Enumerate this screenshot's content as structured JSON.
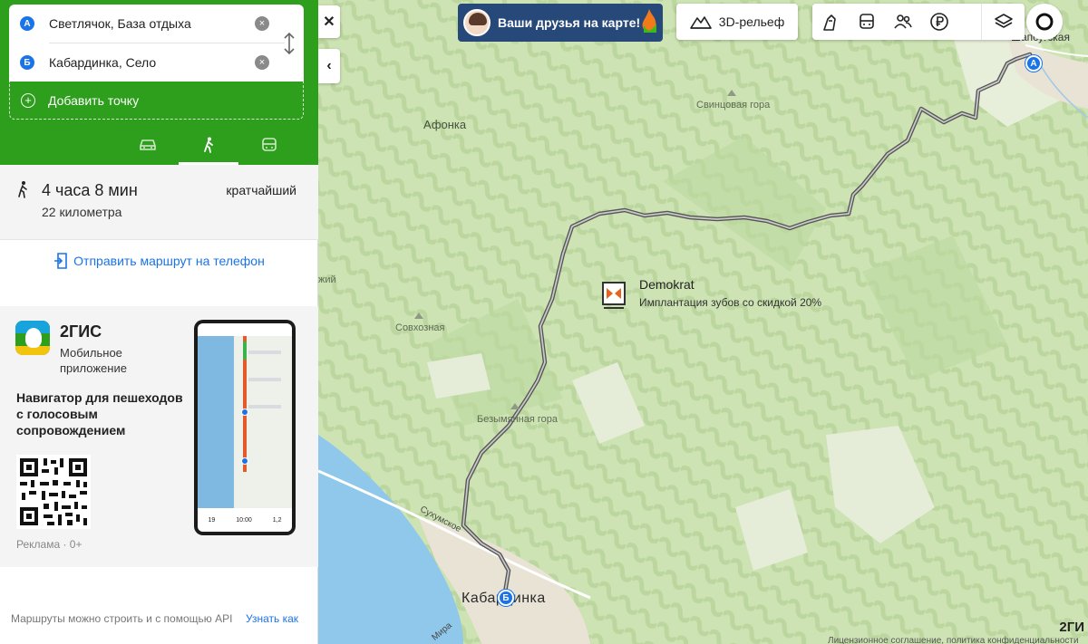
{
  "route": {
    "from": "Светлячок, База отдыха",
    "to": "Кабардинка, Село",
    "from_letter": "А",
    "to_letter": "Б",
    "add_point": "Добавить точку",
    "modes": [
      {
        "icon": "car-icon"
      },
      {
        "icon": "walk-icon",
        "active": true
      },
      {
        "icon": "bus-icon"
      }
    ]
  },
  "result": {
    "duration": "4 часа 8 мин",
    "distance": "22 километра",
    "kind": "кратчайший"
  },
  "send_to_phone": "Отправить маршрут на телефон",
  "promo": {
    "name": "2ГИС",
    "sub1": "Мобильное",
    "sub2": "приложение",
    "description": "Навигатор для пешеходов с голосовым сопровождением",
    "ad": "Реклама · 0+",
    "phone_stats": [
      "19",
      "10:00",
      "1,2"
    ]
  },
  "api_note": "Маршруты можно строить и с помощью API",
  "api_link": "Узнать как",
  "map": {
    "friends_banner": "Ваши друзья на карте!",
    "relief_button": "3D-рельеф",
    "places": {
      "afonka": "Афонка",
      "svincovaya": "Свинцовая гора",
      "sovkhoznaya": "Совхозная",
      "bezymyannaya": "Безымянная гора",
      "shapsugskaya": "Шапсугская",
      "kabardinka": "Кабардинка",
      "left_cut": "жий"
    },
    "roads": {
      "sukhumskoe": "Сухумское",
      "mira": "Мира"
    },
    "ad_title": "Demokrat",
    "ad_subtitle": "Имплантация зубов со скидкой 20%",
    "brand": "2ГИ",
    "license": "Лицензионное соглашение, политика конфиденциальности",
    "colors": {
      "forest": "#cde3b3",
      "sea": "#8fc8ea",
      "route": "#6b6b6b",
      "accent_green": "#2e9e1d",
      "pin_blue": "#1a73e8"
    }
  }
}
